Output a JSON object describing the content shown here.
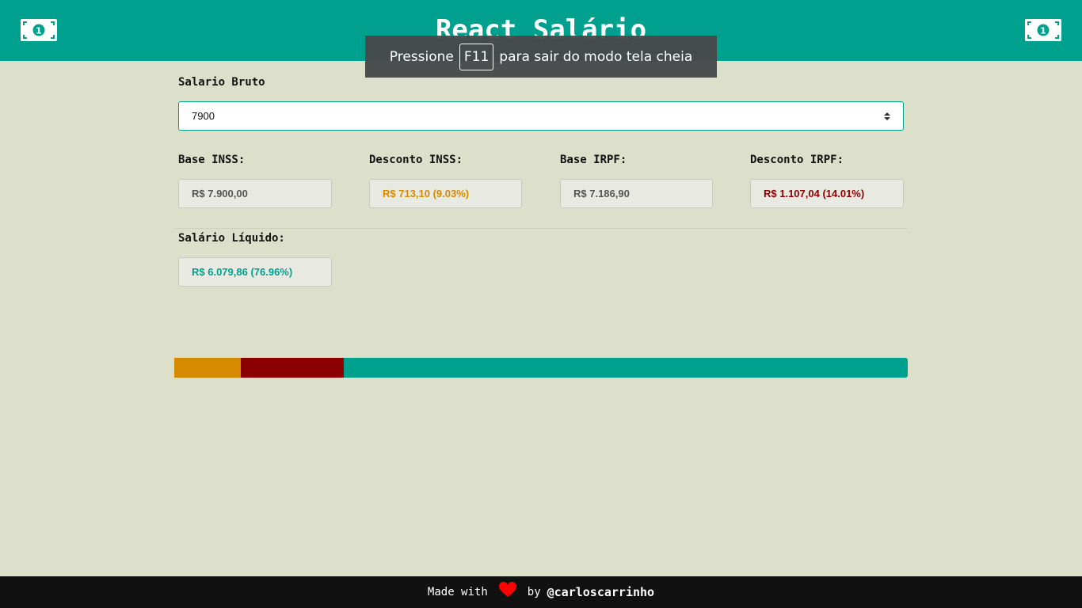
{
  "header": {
    "title": "React Salário",
    "icon": "money-bill-icon"
  },
  "fullscreen_notice": {
    "prefix": "Pressione",
    "key": "F11",
    "suffix": "para sair do modo tela cheia"
  },
  "form": {
    "gross_label": "Salario Bruto",
    "gross_value": "7900",
    "base_inss_label": "Base INSS:",
    "base_inss_value": "R$ 7.900,00",
    "desconto_inss_label": "Desconto INSS:",
    "desconto_inss_value": "R$ 713,10 (9.03%)",
    "base_irpf_label": "Base IRPF:",
    "base_irpf_value": "R$ 7.186,90",
    "desconto_irpf_label": "Desconto IRPF:",
    "desconto_irpf_value": "R$ 1.107,04 (14.01%)",
    "liquido_label": "Salário Líquido:",
    "liquido_value": "R$ 6.079,86 (76.96%)"
  },
  "breakdown_bar": {
    "inss_percent": 9.03,
    "irpf_percent": 14.01,
    "liquido_percent": 76.96
  },
  "footer": {
    "prefix": "Made with",
    "middle": "by",
    "author": "@carloscarrinho"
  },
  "colors": {
    "primary": "#00a08e",
    "background": "#dce0cb",
    "inss": "#d68a00",
    "irpf": "#8b0000",
    "liquido": "#00a08e",
    "heart": "#ff0000"
  }
}
